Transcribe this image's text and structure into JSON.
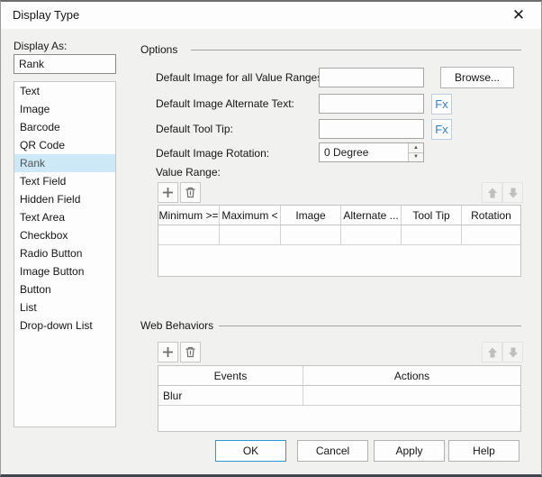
{
  "window": {
    "title": "Display Type",
    "close_glyph": "✕"
  },
  "sidebar": {
    "label": "Display As:",
    "value": "Rank",
    "selected_index": 4,
    "items": [
      "Text",
      "Image",
      "Barcode",
      "QR Code",
      "Rank",
      "Text Field",
      "Hidden Field",
      "Text Area",
      "Checkbox",
      "Radio Button",
      "Image Button",
      "Button",
      "List",
      "Drop-down List"
    ]
  },
  "options": {
    "section_title": "Options",
    "fields": [
      {
        "label": "Default Image for all Value Ranges:",
        "value": ""
      },
      {
        "label": "Default Image Alternate Text:",
        "value": ""
      },
      {
        "label": "Default Tool Tip:",
        "value": ""
      },
      {
        "label": "Default Image Rotation:",
        "value": "0 Degree"
      }
    ],
    "browse_label": "Browse...",
    "fx_label": "Fx",
    "value_range": {
      "label": "Value Range:",
      "columns": [
        "Minimum >=",
        "Maximum <",
        "Image",
        "Alternate ...",
        "Tool Tip",
        "Rotation"
      ],
      "rows": [
        [
          "",
          "",
          "",
          "",
          "",
          ""
        ]
      ]
    }
  },
  "web_behaviors": {
    "section_title": "Web Behaviors",
    "columns": [
      "Events",
      "Actions"
    ],
    "rows": [
      [
        "Blur",
        ""
      ]
    ]
  },
  "icons": {
    "add": "plus",
    "delete": "trash",
    "move_up": "arrow-up",
    "move_down": "arrow-down",
    "spin_up": "▲",
    "spin_down": "▼"
  },
  "footer": {
    "buttons": [
      "OK",
      "Cancel",
      "Apply",
      "Help"
    ]
  },
  "colors": {
    "accent_blue": "#2799d4",
    "fx_blue": "#2f7fd0",
    "selection_blue": "#cde8f6",
    "body_bg": "#f1f1ef",
    "titlebar_bg": "#fdfdfd"
  }
}
